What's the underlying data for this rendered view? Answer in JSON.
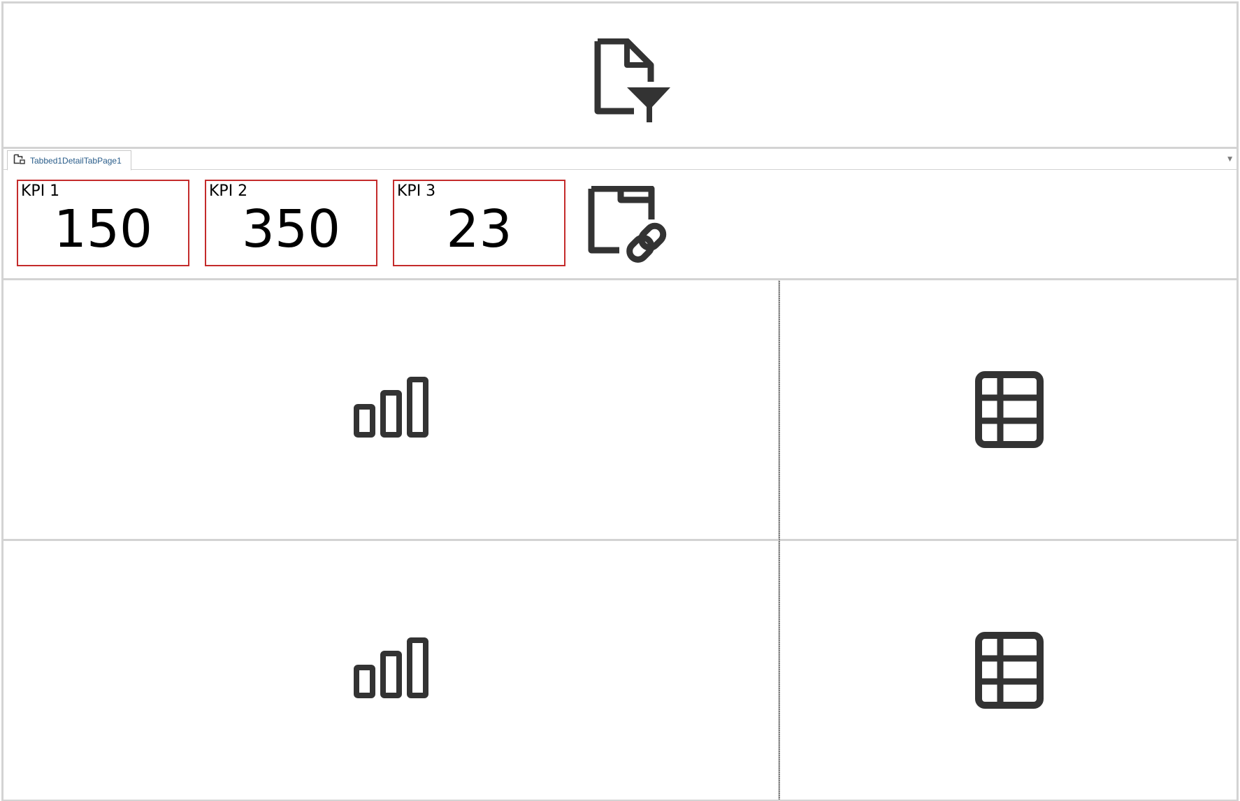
{
  "colors": {
    "icon": "#333333",
    "kpi_border": "#c42b2b",
    "panel_border": "#d3d3d3",
    "tab_text": "#2a5d8a"
  },
  "filter_panel": {
    "icon": "document-filter-icon"
  },
  "tab_panel": {
    "tabs": [
      {
        "label": "Tabbed1DetailTabPage1",
        "icon": "tab-page-icon",
        "selected": true
      }
    ],
    "dropdown_icon": "chevron-down-icon",
    "kpis": [
      {
        "title": "KPI 1",
        "value": "150"
      },
      {
        "title": "KPI 2",
        "value": "350"
      },
      {
        "title": "KPI 3",
        "value": "23"
      }
    ],
    "link_icon": "folder-link-icon"
  },
  "panels": [
    {
      "type": "chart",
      "icon": "bar-chart-icon"
    },
    {
      "type": "grid",
      "icon": "table-grid-icon"
    },
    {
      "type": "chart",
      "icon": "bar-chart-icon"
    },
    {
      "type": "grid",
      "icon": "table-grid-icon"
    }
  ]
}
